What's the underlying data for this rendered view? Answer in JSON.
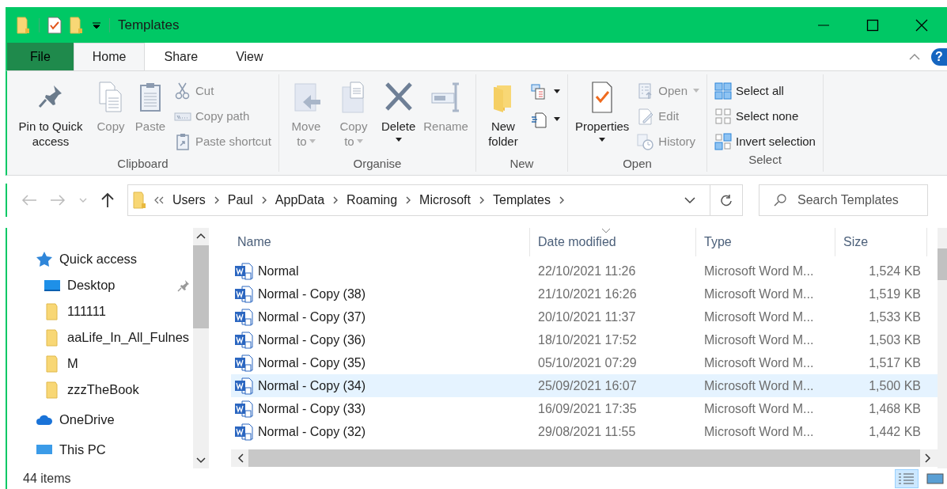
{
  "window": {
    "title": "Templates"
  },
  "tabs": [
    {
      "label": "File",
      "kind": "file",
      "selected": false
    },
    {
      "label": "Home",
      "kind": "tab",
      "selected": true
    },
    {
      "label": "Share",
      "kind": "tab",
      "selected": false
    },
    {
      "label": "View",
      "kind": "tab",
      "selected": false
    }
  ],
  "help": "?",
  "ribbon": {
    "groups": [
      {
        "label": "Clipboard",
        "items": [
          {
            "kind": "large",
            "label": "Pin to Quick access",
            "disabled": false,
            "dropdown": false
          },
          {
            "kind": "large",
            "label": "Copy",
            "disabled": true,
            "dropdown": false
          },
          {
            "kind": "large",
            "label": "Paste",
            "disabled": true,
            "dropdown": false
          },
          {
            "kind": "small",
            "label": "Cut",
            "disabled": true,
            "dropdown": false
          },
          {
            "kind": "small",
            "label": "Copy path",
            "disabled": true,
            "dropdown": false
          },
          {
            "kind": "small",
            "label": "Paste shortcut",
            "disabled": true,
            "dropdown": false
          }
        ]
      },
      {
        "label": "Organise",
        "items": [
          {
            "kind": "large",
            "label": "Move to",
            "disabled": true,
            "dropdown": true
          },
          {
            "kind": "large",
            "label": "Copy to",
            "disabled": true,
            "dropdown": true
          },
          {
            "kind": "large",
            "label": "Delete",
            "disabled": false,
            "dropdown": true
          },
          {
            "kind": "large",
            "label": "Rename",
            "disabled": true,
            "dropdown": false
          }
        ]
      },
      {
        "label": "New",
        "items": [
          {
            "kind": "large",
            "label": "New folder",
            "disabled": false,
            "dropdown": false
          },
          {
            "kind": "icon",
            "disabled": false,
            "dropdown": true
          },
          {
            "kind": "icon",
            "disabled": false,
            "dropdown": true
          }
        ]
      },
      {
        "label": "Open",
        "items": [
          {
            "kind": "large",
            "label": "Properties",
            "disabled": false,
            "dropdown": true
          },
          {
            "kind": "small",
            "label": "Open",
            "disabled": true,
            "dropdown": true
          },
          {
            "kind": "small",
            "label": "Edit",
            "disabled": true,
            "dropdown": false
          },
          {
            "kind": "small",
            "label": "History",
            "disabled": true,
            "dropdown": false
          }
        ]
      },
      {
        "label": "Select",
        "items": [
          {
            "kind": "small",
            "label": "Select all",
            "disabled": false,
            "dropdown": false
          },
          {
            "kind": "small",
            "label": "Select none",
            "disabled": false,
            "dropdown": false
          },
          {
            "kind": "small",
            "label": "Invert selection",
            "disabled": false,
            "dropdown": false
          }
        ]
      }
    ]
  },
  "address": {
    "path": [
      "Users",
      "Paul",
      "AppData",
      "Roaming",
      "Microsoft",
      "Templates"
    ]
  },
  "search": {
    "placeholder": "Search Templates"
  },
  "navigation": [
    {
      "label": "Quick access",
      "kind": "star",
      "pinned": false,
      "children": [
        {
          "label": "Desktop",
          "kind": "desktop",
          "pinned": true
        },
        {
          "label": "111111",
          "kind": "folder",
          "pinned": false
        },
        {
          "label": "aaLife_In_All_Fulnes",
          "kind": "folder",
          "pinned": false
        },
        {
          "label": "M",
          "kind": "folder",
          "pinned": false
        },
        {
          "label": "zzzTheBook",
          "kind": "folder",
          "pinned": false
        }
      ]
    },
    {
      "label": "OneDrive",
      "kind": "cloud",
      "pinned": false
    },
    {
      "label": "This PC",
      "kind": "pc",
      "pinned": false
    }
  ],
  "table": {
    "columns": [
      {
        "label": "Name",
        "sorted": false
      },
      {
        "label": "Date modified",
        "sorted": true
      },
      {
        "label": "Type",
        "sorted": false
      },
      {
        "label": "Size",
        "sorted": false
      }
    ],
    "rows": [
      {
        "name": "Normal",
        "date": "22/10/2021 11:26",
        "type": "Microsoft Word M...",
        "size": "1,524 KB",
        "selected": false
      },
      {
        "name": "Normal - Copy (38)",
        "date": "21/10/2021 16:26",
        "type": "Microsoft Word M...",
        "size": "1,519 KB",
        "selected": false
      },
      {
        "name": "Normal - Copy (37)",
        "date": "20/10/2021 11:37",
        "type": "Microsoft Word M...",
        "size": "1,533 KB",
        "selected": false
      },
      {
        "name": "Normal - Copy (36)",
        "date": "18/10/2021 17:52",
        "type": "Microsoft Word M...",
        "size": "1,503 KB",
        "selected": false
      },
      {
        "name": "Normal - Copy (35)",
        "date": "05/10/2021 07:29",
        "type": "Microsoft Word M...",
        "size": "1,517 KB",
        "selected": false
      },
      {
        "name": "Normal - Copy (34)",
        "date": "25/09/2021 16:07",
        "type": "Microsoft Word M...",
        "size": "1,500 KB",
        "selected": true
      },
      {
        "name": "Normal - Copy (33)",
        "date": "16/09/2021 17:35",
        "type": "Microsoft Word M...",
        "size": "1,468 KB",
        "selected": false
      },
      {
        "name": "Normal - Copy (32)",
        "date": "29/08/2021 11:55",
        "type": "Microsoft Word M...",
        "size": "1,442 KB",
        "selected": false
      }
    ]
  },
  "status_bar": {
    "items": "44 items"
  },
  "views": [
    {
      "kind": "details",
      "selected": true
    },
    {
      "kind": "large-icons",
      "selected": false
    }
  ]
}
